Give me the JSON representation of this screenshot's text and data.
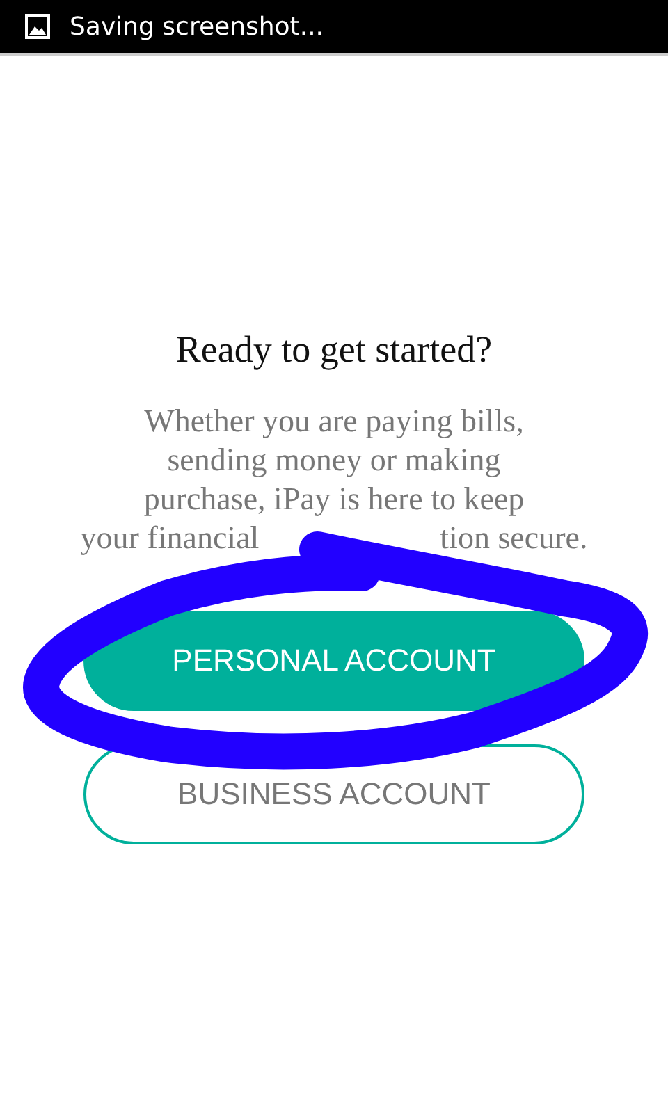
{
  "status_bar": {
    "text": "Saving screenshot..."
  },
  "title": "Ready to get started?",
  "description": {
    "lines": [
      "Whether you are paying bills,",
      "sending money or making",
      "purchase, iPay is here to keep"
    ],
    "last_line": [
      "your financial",
      "tion secure."
    ]
  },
  "buttons": [
    {
      "label": "PERSONAL ACCOUNT",
      "kind": "filled"
    },
    {
      "label": "BUSINESS ACCOUNT",
      "kind": "outline"
    }
  ]
}
